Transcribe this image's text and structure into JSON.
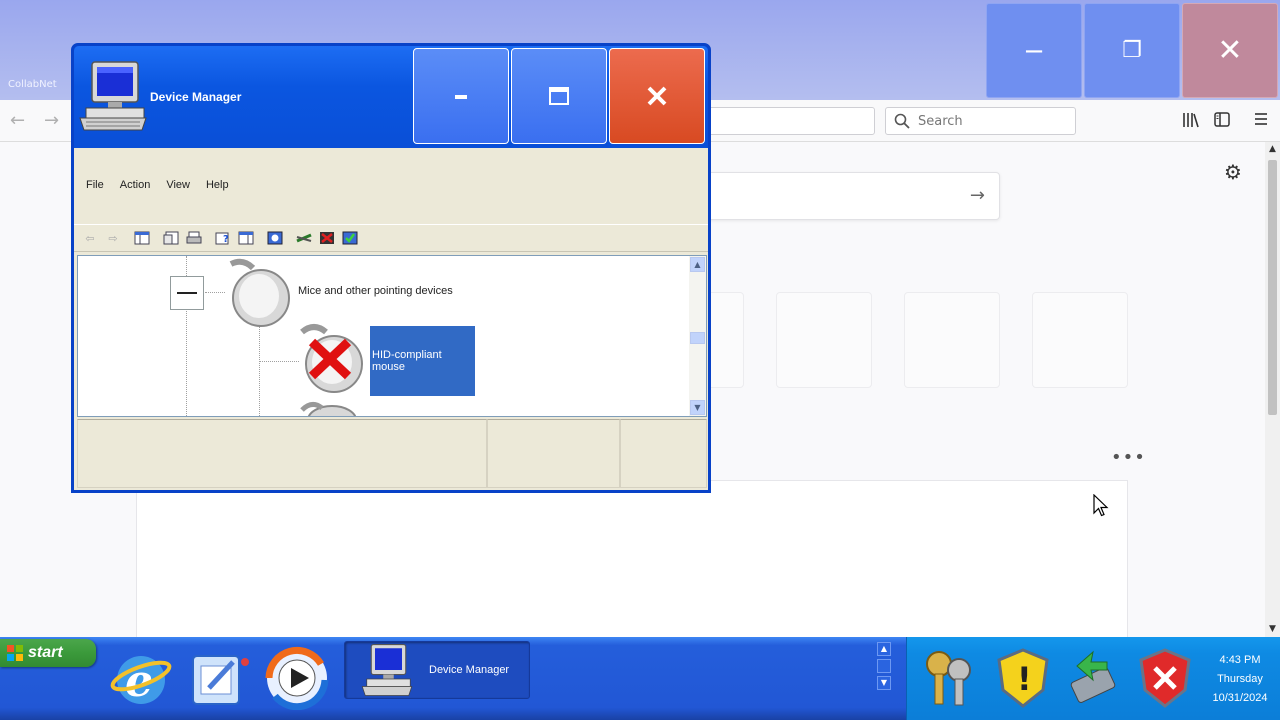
{
  "background_browser": {
    "brand_label": "CollabNet",
    "search_placeholder": "Search",
    "window_controls": {
      "minimize": "‒",
      "restore": "❐",
      "close": "✕"
    },
    "nav": {
      "back_icon": "arrow-left-icon",
      "forward_icon": "arrow-right-icon"
    },
    "toolbar_icons": [
      "library-icon",
      "sidebar-icon",
      "hamburger-menu-icon"
    ],
    "content": {
      "more_label": "•••",
      "go_arrow": "→",
      "settings_icon": "⚙"
    }
  },
  "device_manager": {
    "title": "Device Manager",
    "menu": [
      "File",
      "Action",
      "View",
      "Help"
    ],
    "tree": {
      "category_label": "Mice and other pointing devices",
      "selected_device_label": "HID-compliant mouse"
    },
    "colors": {
      "titlebar": "#0a54e3",
      "close": "#e05a36",
      "selection": "#316ac5",
      "body": "#ece9d8"
    }
  },
  "taskbar": {
    "start_label": "start",
    "quick_launch": [
      "internet-explorer-icon",
      "outlook-express-icon",
      "windows-media-player-icon"
    ],
    "task_items": [
      {
        "label": "Device Manager"
      }
    ],
    "tray_icons": [
      "keys-icon",
      "security-warning-icon",
      "network-icon",
      "security-center-alert-icon"
    ],
    "clock": {
      "time": "4:43 PM",
      "day": "Thursday",
      "date": "10/31/2024"
    }
  }
}
